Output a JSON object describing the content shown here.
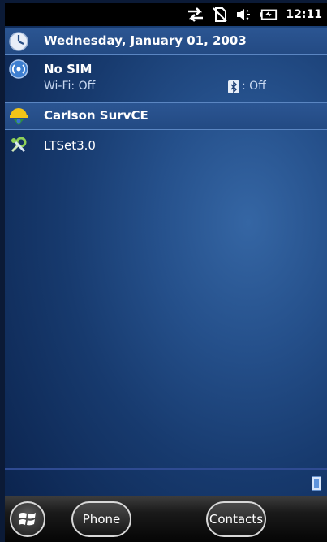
{
  "status_bar": {
    "icons": [
      "sync-arrows-icon",
      "no-sim-icon",
      "speaker-icon",
      "battery-icon"
    ],
    "time": "12:11"
  },
  "today": {
    "date": "Wednesday, January 01, 2003",
    "connectivity": {
      "title": "No SIM",
      "wifi": "Wi-Fi: Off",
      "bluetooth": ": Off"
    },
    "app1": "Carlson SurvCE",
    "app2": "LTSet3.0"
  },
  "softkeys": {
    "left": "Phone",
    "right": "Contacts"
  },
  "colors": {
    "background_center": "#3566a4",
    "background_edge": "#0c2550",
    "highlight": "#2b5592",
    "status_bar": "#000000"
  }
}
